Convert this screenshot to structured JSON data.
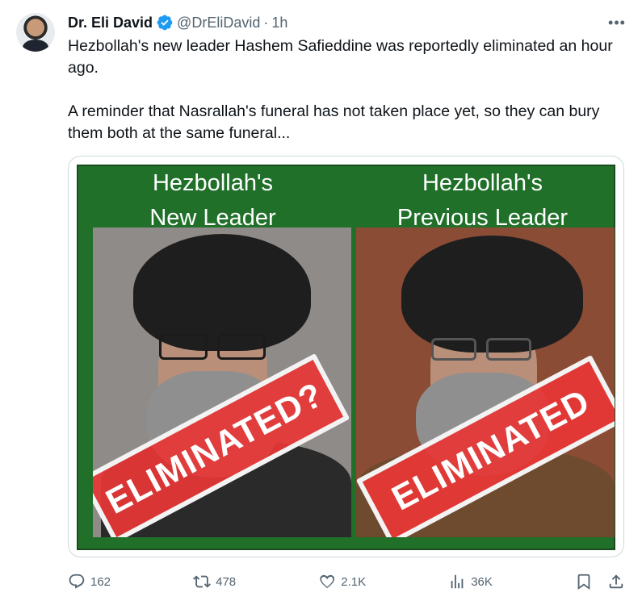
{
  "tweet": {
    "author": {
      "name": "Dr. Eli David",
      "handle": "@DrEliDavid",
      "separator": "·",
      "time": "1h"
    },
    "text": {
      "paragraph_1": "Hezbollah's new leader Hashem Safieddine was reportedly eliminated an hour ago.",
      "paragraph_2": "A reminder that Nasrallah's funeral has not taken place yet, so they can bury them both at the same funeral..."
    },
    "media": {
      "left_caption": "Hezbollah's\nNew Leader",
      "right_caption": "Hezbollah's\nPrevious Leader",
      "left_stamp": "ELIMINATED?",
      "right_stamp": "ELIMINATED"
    },
    "metrics": {
      "replies": "162",
      "reposts": "478",
      "likes": "2.1K",
      "views": "36K"
    }
  },
  "icons": {
    "verified": "verified-badge-icon",
    "more": "more-horizontal-icon",
    "reply": "reply-icon",
    "repost": "repost-icon",
    "like": "heart-icon",
    "views": "views-icon",
    "bookmark": "bookmark-icon",
    "share": "share-icon"
  },
  "colors": {
    "text": "#0f1419",
    "secondary": "#536471",
    "verified": "#1d9bf0",
    "meme_green": "#20702a",
    "stamp_red": "#e83636"
  }
}
